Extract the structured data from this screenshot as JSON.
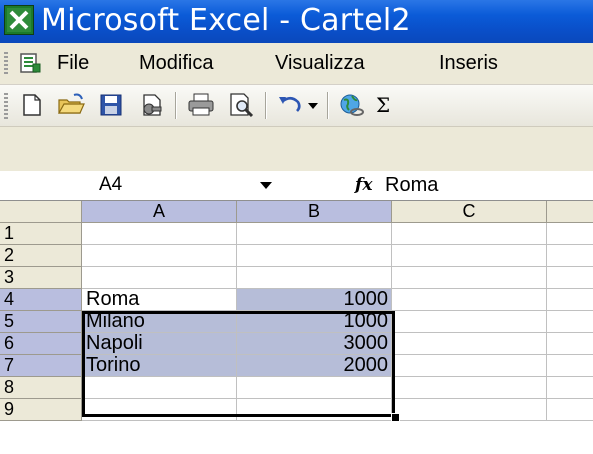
{
  "window": {
    "title": "Microsoft Excel - Cartel2",
    "icon": "excel-icon"
  },
  "menu": {
    "items": [
      "File",
      "Modifica",
      "Visualizza",
      "Inseris"
    ]
  },
  "toolbar": {
    "buttons": [
      "new-icon",
      "open-icon",
      "save-icon",
      "permission-icon",
      "print-icon",
      "print-preview-icon",
      "undo-icon",
      "undo-dropdown-icon",
      "insert-hyperlink-icon",
      "autosum-icon"
    ]
  },
  "formula_bar": {
    "name_box": "A4",
    "fx_label": "fx",
    "value": "Roma"
  },
  "sheet": {
    "columns": [
      "A",
      "B",
      "C"
    ],
    "rows": [
      {
        "num": "1",
        "a": "",
        "b": ""
      },
      {
        "num": "2",
        "a": "",
        "b": ""
      },
      {
        "num": "3",
        "a": "",
        "b": ""
      },
      {
        "num": "4",
        "a": "Roma",
        "b": "1000"
      },
      {
        "num": "5",
        "a": "Milano",
        "b": "1000"
      },
      {
        "num": "6",
        "a": "Napoli",
        "b": "3000"
      },
      {
        "num": "7",
        "a": "Torino",
        "b": "2000"
      },
      {
        "num": "8",
        "a": "",
        "b": ""
      },
      {
        "num": "9",
        "a": "",
        "b": ""
      }
    ],
    "active_cell": "A4",
    "selection": "A4:B7"
  },
  "colors": {
    "title_bar": "#0a52d0",
    "chrome": "#ece9d8",
    "selection": "#b6bdd8",
    "header_active": "#b9bedf"
  }
}
